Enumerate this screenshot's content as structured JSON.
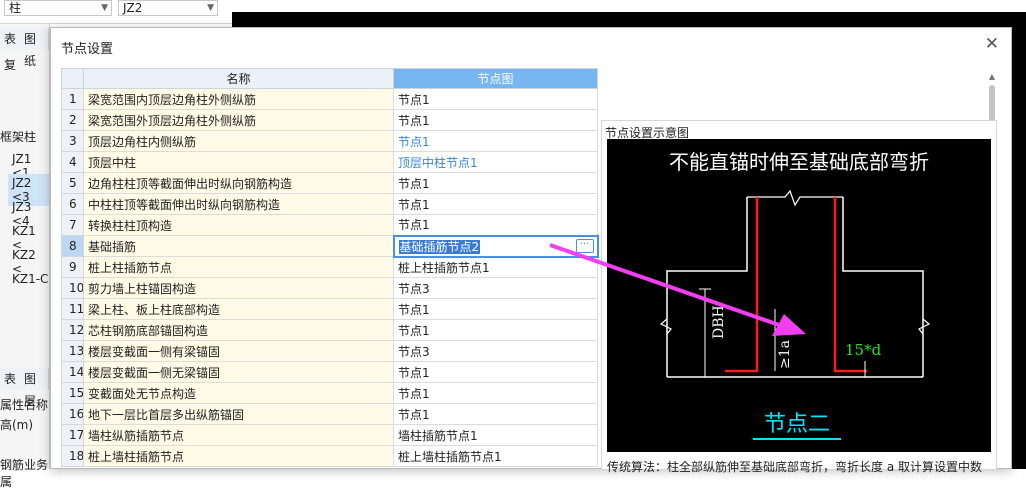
{
  "app": {
    "toolbar": {
      "combo1": "柱",
      "combo2": "JZ2"
    },
    "left_panel": {
      "tabs_top": [
        "表",
        "图纸"
      ],
      "tool_label": "复",
      "tree_group": "框架柱",
      "tree_items": [
        "JZ1 <1",
        "JZ2 <3",
        "JZ3 <4",
        "KZ1 <",
        "KZ2 <",
        "KZ1-C"
      ],
      "tabs_bottom": [
        "表",
        "图层"
      ],
      "prop_labels": [
        "属性名称",
        "高(m)",
        "钢筋业务属"
      ]
    }
  },
  "dialog": {
    "title": "节点设置",
    "close_glyph": "✕",
    "table": {
      "header_name": "名称",
      "header_node": "节点图",
      "rows": [
        {
          "idx": "1",
          "name": "梁宽范围内顶层边角柱外侧纵筋",
          "node": "节点1"
        },
        {
          "idx": "2",
          "name": "梁宽范围外顶层边角柱外侧纵筋",
          "node": "节点1"
        },
        {
          "idx": "3",
          "name": "顶层边角柱内侧纵筋",
          "node": "节点1"
        },
        {
          "idx": "4",
          "name": "顶层中柱",
          "node": "顶层中柱节点1"
        },
        {
          "idx": "5",
          "name": "边角柱柱顶等截面伸出时纵向钢筋构造",
          "node": "节点1"
        },
        {
          "idx": "6",
          "name": "中柱柱顶等截面伸出时纵向钢筋构造",
          "node": "节点1"
        },
        {
          "idx": "7",
          "name": "转换柱柱顶构造",
          "node": "节点1"
        },
        {
          "idx": "8",
          "name": "基础插筋",
          "node": "基础插筋节点2"
        },
        {
          "idx": "9",
          "name": "桩上柱插筋节点",
          "node": "桩上柱插筋节点1"
        },
        {
          "idx": "10",
          "name": "剪力墙上柱锚固构造",
          "node": "节点3"
        },
        {
          "idx": "11",
          "name": "梁上柱、板上柱底部构造",
          "node": "节点1"
        },
        {
          "idx": "12",
          "name": "芯柱钢筋底部锚固构造",
          "node": "节点1"
        },
        {
          "idx": "13",
          "name": "楼层变截面一侧有梁锚固",
          "node": "节点3"
        },
        {
          "idx": "14",
          "name": "楼层变截面一侧无梁锚固",
          "node": "节点1"
        },
        {
          "idx": "15",
          "name": "变截面处无节点构造",
          "node": "节点1"
        },
        {
          "idx": "16",
          "name": "地下一层比首层多出纵筋锚固",
          "node": "节点1"
        },
        {
          "idx": "17",
          "name": "墙柱纵筋插筋节点",
          "node": "墙柱插筋节点1"
        },
        {
          "idx": "18",
          "name": "桩上墙柱插筋节点",
          "node": "桩上墙柱插筋节点1"
        }
      ],
      "selected_idx": "8",
      "ellipsis_label": "···"
    },
    "preview": {
      "label": "节点设置示意图",
      "image_title": "不能直锚时伸至基础底部弯折",
      "dim_left": "DBH",
      "dim_mid": "≥1a",
      "dim_hook": "15*d",
      "node_caption": "节点二",
      "description": "传统算法：柱全部纵筋伸至基础底部弯折，弯折长度 a 取计算设置中数"
    }
  },
  "colors": {
    "header_blue": "#77b6f0",
    "link_blue": "#3a86d4",
    "name_cell_bg": "#fffbe7",
    "arrow_magenta": "#f03ef0",
    "rebar_red": "#ff1a1a",
    "caption_cyan": "#00e5ff"
  }
}
